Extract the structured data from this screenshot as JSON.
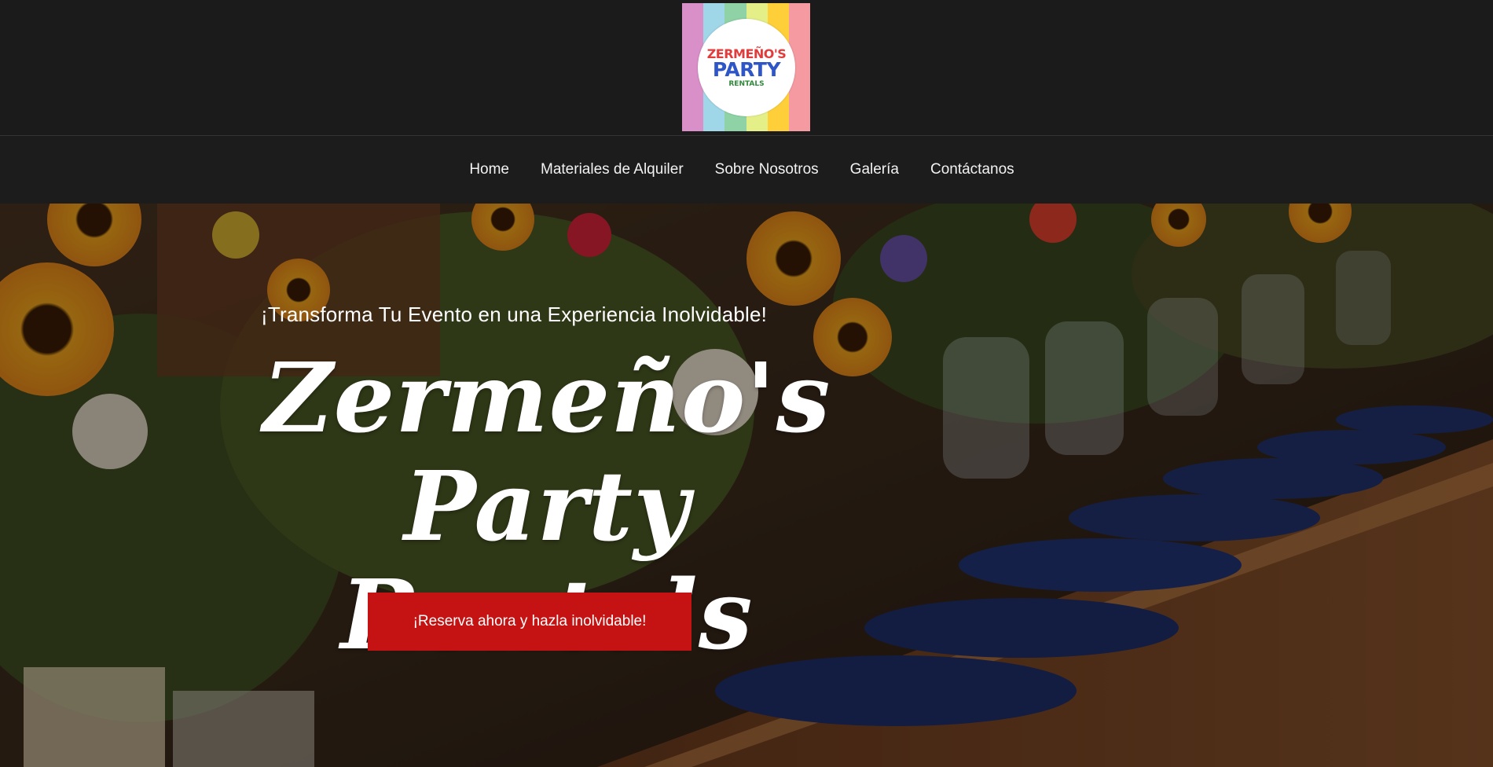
{
  "logo": {
    "line1": "ZERMEÑO'S",
    "line2": "PARTY",
    "line3": "RENTALS",
    "stripe_colors": [
      "#d98fc7",
      "#9fd6e8",
      "#8ed2a5",
      "#e4ef87",
      "#ffcf3a",
      "#f49aa0"
    ]
  },
  "nav": {
    "items": [
      "Home",
      "Materiales de Alquiler",
      "Sobre Nosotros",
      "Galería",
      "Contáctanos"
    ]
  },
  "hero": {
    "tagline": "¡Transforma Tu Evento en una Experiencia Inolvidable!",
    "brand_line1": "Zermeño's",
    "brand_line2": "Party Rentals",
    "cta_label": "¡Reserva ahora y hazla inolvidable!",
    "cta_color": "#c51212"
  }
}
